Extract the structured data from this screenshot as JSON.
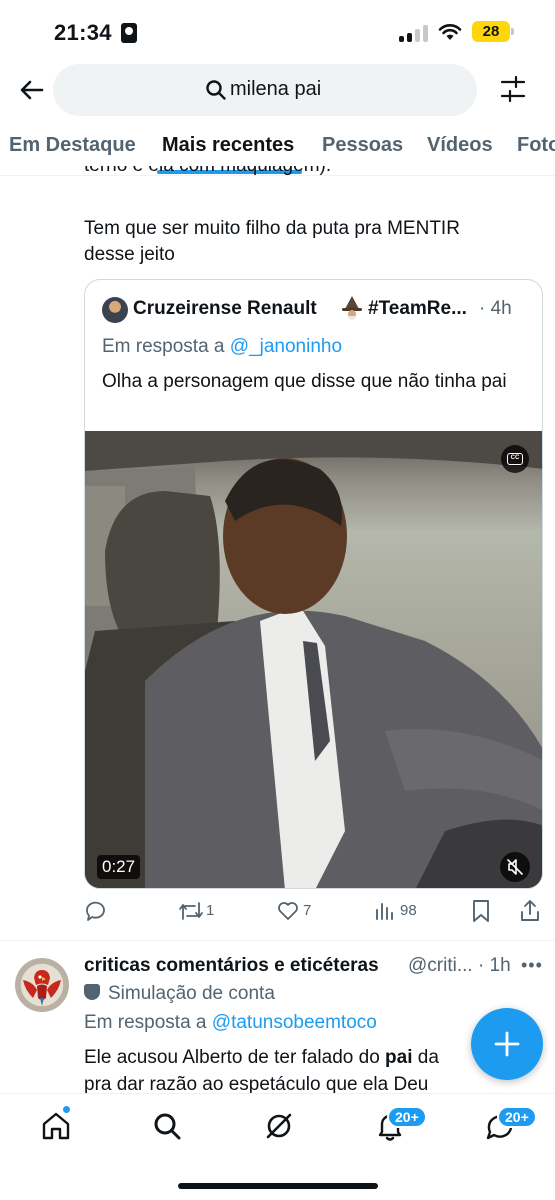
{
  "status_bar": {
    "time": "21:34",
    "battery": "28",
    "icons": [
      "person-card-icon",
      "signal-icon",
      "wifi-icon",
      "battery-icon"
    ]
  },
  "search": {
    "query": "milena pai"
  },
  "tabs": [
    {
      "label": "Em Destaque",
      "active": false
    },
    {
      "label": "Mais recentes",
      "active": true
    },
    {
      "label": "Pessoas",
      "active": false
    },
    {
      "label": "Vídeos",
      "active": false
    },
    {
      "label": "Fotos",
      "active": false
    }
  ],
  "tweet1": {
    "partial_line": "terno e ela com maquiagem).",
    "text_line_1": "Tem que ser muito filho da puta pra MENTIR",
    "text_line_2": "desse jeito",
    "quote": {
      "author_name": "Cruzeirense Renault",
      "author_tag": "#TeamRe...",
      "time": "· 4h",
      "reply_prefix": "Em resposta a ",
      "reply_handle": "@_janoninho",
      "text": "Olha a personagem que disse que não tinha pai",
      "video_duration": "0:27"
    },
    "actions": {
      "reply_count": "",
      "retweet_count": "1",
      "like_count": "7",
      "view_count": "98"
    }
  },
  "tweet2": {
    "author_name": "criticas comentários e eticéteras",
    "handle_time": "@criti... · 1h",
    "label": "Simulação de conta",
    "reply_prefix": "Em resposta a ",
    "reply_handle": "@tatunsobeemtoco",
    "text_before": "Ele acusou Alberto de ter falado do ",
    "text_bold": "pai",
    "text_after": " da",
    "text_line_2": "pra dar razão ao espetáculo que ela Deu"
  },
  "bottom_nav": {
    "notifications_badge": "20+",
    "messages_badge": "20+"
  },
  "colors": {
    "accent": "#1d9bf0",
    "text_primary": "#0f1419",
    "text_secondary": "#536471"
  }
}
